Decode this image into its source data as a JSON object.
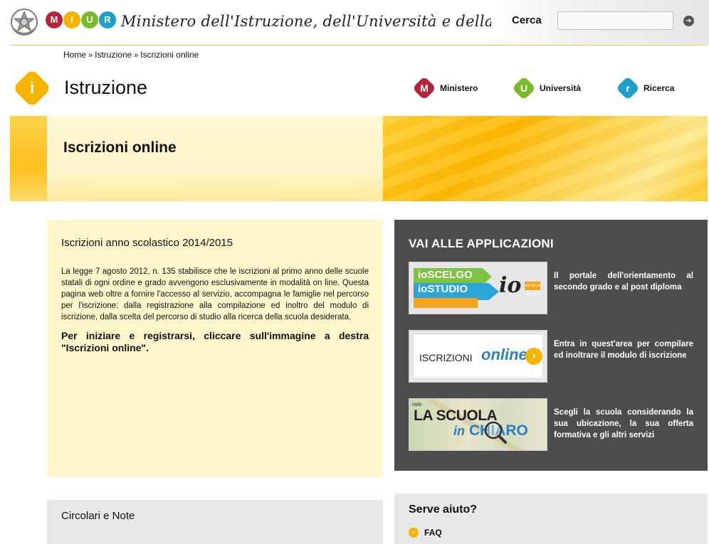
{
  "header": {
    "miur_letters": [
      "M",
      "I",
      "U",
      "R"
    ],
    "miur_colors": [
      "#b5243a",
      "#f5b400",
      "#7ab929",
      "#1f9ec9"
    ],
    "ministry_title": "Ministero dell'Istruzione, dell'Università e della Ricerca",
    "search_label": "Cerca",
    "search_placeholder": "",
    "search_button_glyph": "➔"
  },
  "breadcrumb": {
    "items": [
      "Home",
      "Istruzione",
      "Iscrizioni online"
    ],
    "separator": "»"
  },
  "section": {
    "icon_letter": "i",
    "title": "Istruzione",
    "nav": [
      {
        "letter": "M",
        "label": "Ministero",
        "color": "#b5243a"
      },
      {
        "letter": "U",
        "label": "Università",
        "color": "#7ab929"
      },
      {
        "letter": "r",
        "label": "Ricerca",
        "color": "#1f9ec9"
      }
    ]
  },
  "banner": {
    "title": "Iscrizioni online"
  },
  "intro": {
    "heading": "Iscrizioni anno scolastico 2014/2015",
    "body": "La legge 7 agosto 2012, n. 135 stabilisce che le iscrizioni al primo anno delle scuole statali di ogni ordine e grado avvengono esclusivamente in modalità on line. Questa pagina web oltre a fornire l'accesso al servizio, accompagna le famiglie nel percorso per l'iscrizione: dalla registrazione alla compilazione ed inoltro del modulo di iscrizione, dalla scelta del percorso di studio alla ricerca della scuola desiderata.",
    "cta": "Per iniziare e registrarsi, cliccare sull'immagine a destra \"Iscrizioni online\"."
  },
  "apps": {
    "heading": "VAI ALLE APPLICAZIONI",
    "items": [
      {
        "thumb_line1": "ioSCELGO",
        "thumb_line2": "ioSTUDIO",
        "thumb_mark": "io",
        "thumb_tag": "ioSCELGO ioSTUDIO",
        "description": "Il portale dell'orientamento al secondo grado e al post diploma"
      },
      {
        "thumb_text": "ISCRIZIONI",
        "thumb_online": "online",
        "thumb_arrow": "›",
        "description": "Entra in quest'area per compilare ed inoltrare il modulo di iscrizione"
      },
      {
        "thumb_rale": "rale",
        "thumb_text": "LA SCUOLA",
        "thumb_in": "in",
        "thumb_chiaro": "CHIARO",
        "description": "Scegli la scuola considerando la sua ubicazione, la sua offerta formativa e gli altri servizi"
      }
    ]
  },
  "circolari": {
    "title": "Circolari e Note"
  },
  "help": {
    "title": "Serve aiuto?",
    "faq_label": "FAQ",
    "faq_glyph": "›"
  }
}
